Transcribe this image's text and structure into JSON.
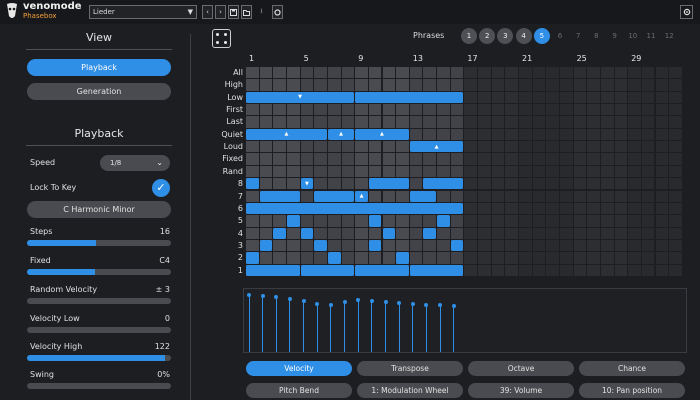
{
  "app": {
    "brand": "venomode",
    "product": "Phasebox"
  },
  "toolbar": {
    "preset": "Lieder",
    "prev": "‹",
    "next": "›",
    "save": "💾",
    "load": "📂",
    "export": "⭳",
    "gear": "⚙"
  },
  "view": {
    "title": "View",
    "playback_label": "Playback",
    "generation_label": "Generation"
  },
  "playback": {
    "title": "Playback",
    "speed_label": "Speed",
    "speed_value": "1/8",
    "lock_label": "Lock To Key",
    "lock_checked": true,
    "scale_label": "C Harmonic Minor",
    "steps_label": "Steps",
    "steps_value": "16",
    "steps_fill": 0.48,
    "fixed_label": "Fixed",
    "fixed_value": "C4",
    "fixed_fill": 0.47,
    "random_velocity_label": "Random Velocity",
    "random_velocity_value": "± 3",
    "velocity_low_label": "Velocity Low",
    "velocity_low_value": "0",
    "velocity_high_label": "Velocity High",
    "velocity_high_value": "122",
    "velocity_high_fill": 0.96,
    "swing_label": "Swing",
    "swing_value": "0%"
  },
  "phrases": {
    "label": "Phrases",
    "items": [
      "1",
      "2",
      "3",
      "4",
      "5",
      "6",
      "7",
      "8",
      "9",
      "10",
      "11",
      "12"
    ],
    "active_count": 5,
    "selected": 5
  },
  "grid": {
    "column_numbers": [
      {
        "label": "1",
        "col": 0
      },
      {
        "label": "5",
        "col": 4
      },
      {
        "label": "9",
        "col": 8
      },
      {
        "label": "13",
        "col": 12
      },
      {
        "label": "17",
        "col": 16
      },
      {
        "label": "21",
        "col": 20
      },
      {
        "label": "25",
        "col": 24
      },
      {
        "label": "29",
        "col": 28
      }
    ],
    "row_labels": [
      "All",
      "High",
      "Low",
      "First",
      "Last",
      "Quiet",
      "Loud",
      "Fixed",
      "Rand",
      "8",
      "7",
      "6",
      "5",
      "4",
      "3",
      "2",
      "1"
    ],
    "active_cols": 16,
    "total_cols": 32,
    "notes": [
      {
        "row": 2,
        "start": 0,
        "len": 8,
        "mark": "▼"
      },
      {
        "row": 2,
        "start": 8,
        "len": 8,
        "mark": ""
      },
      {
        "row": 5,
        "start": 0,
        "len": 6,
        "mark": "▲"
      },
      {
        "row": 5,
        "start": 6,
        "len": 2,
        "mark": "▲"
      },
      {
        "row": 5,
        "start": 8,
        "len": 4,
        "mark": "▲"
      },
      {
        "row": 6,
        "start": 12,
        "len": 4,
        "mark": "▲"
      },
      {
        "row": 9,
        "start": 0,
        "len": 1,
        "mark": ""
      },
      {
        "row": 9,
        "start": 4,
        "len": 1,
        "mark": "▼"
      },
      {
        "row": 9,
        "start": 9,
        "len": 3,
        "mark": ""
      },
      {
        "row": 9,
        "start": 13,
        "len": 3,
        "mark": ""
      },
      {
        "row": 10,
        "start": 1,
        "len": 3,
        "mark": ""
      },
      {
        "row": 10,
        "start": 5,
        "len": 3,
        "mark": ""
      },
      {
        "row": 10,
        "start": 8,
        "len": 1,
        "mark": "▲"
      },
      {
        "row": 10,
        "start": 12,
        "len": 2,
        "mark": ""
      },
      {
        "row": 11,
        "start": 0,
        "len": 16,
        "mark": ""
      },
      {
        "row": 12,
        "start": 3,
        "len": 1,
        "mark": ""
      },
      {
        "row": 12,
        "start": 9,
        "len": 1,
        "mark": ""
      },
      {
        "row": 12,
        "start": 14,
        "len": 1,
        "mark": ""
      },
      {
        "row": 13,
        "start": 2,
        "len": 1,
        "mark": ""
      },
      {
        "row": 13,
        "start": 4,
        "len": 1,
        "mark": ""
      },
      {
        "row": 13,
        "start": 10,
        "len": 1,
        "mark": ""
      },
      {
        "row": 13,
        "start": 13,
        "len": 1,
        "mark": ""
      },
      {
        "row": 14,
        "start": 1,
        "len": 1,
        "mark": ""
      },
      {
        "row": 14,
        "start": 5,
        "len": 1,
        "mark": ""
      },
      {
        "row": 14,
        "start": 9,
        "len": 1,
        "mark": ""
      },
      {
        "row": 14,
        "start": 15,
        "len": 1,
        "mark": ""
      },
      {
        "row": 15,
        "start": 0,
        "len": 1,
        "mark": ""
      },
      {
        "row": 15,
        "start": 6,
        "len": 1,
        "mark": ""
      },
      {
        "row": 15,
        "start": 11,
        "len": 1,
        "mark": ""
      },
      {
        "row": 16,
        "start": 0,
        "len": 4,
        "mark": ""
      },
      {
        "row": 16,
        "start": 4,
        "len": 4,
        "mark": ""
      },
      {
        "row": 16,
        "start": 8,
        "len": 4,
        "mark": ""
      },
      {
        "row": 16,
        "start": 12,
        "len": 4,
        "mark": ""
      }
    ]
  },
  "velocities": [
    0.96,
    0.95,
    0.93,
    0.9,
    0.87,
    0.82,
    0.8,
    0.85,
    0.88,
    0.86,
    0.84,
    0.83,
    0.81,
    0.8,
    0.79,
    0.78
  ],
  "tabs_row1": [
    {
      "label": "Velocity",
      "active": true
    },
    {
      "label": "Transpose",
      "active": false
    },
    {
      "label": "Octave",
      "active": false
    },
    {
      "label": "Chance",
      "active": false
    }
  ],
  "tabs_row2": [
    {
      "label": "Pitch Bend"
    },
    {
      "label": "1: Modulation Wheel"
    },
    {
      "label": "39: Volume"
    },
    {
      "label": "10: Pan position"
    }
  ]
}
